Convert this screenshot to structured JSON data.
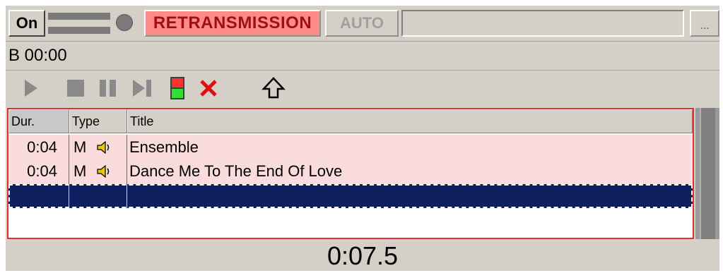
{
  "topbar": {
    "on_label": "On",
    "retransmission_label": "RETRANSMISSION",
    "auto_label": "AUTO",
    "status_text": "",
    "more_label": "..."
  },
  "time_line": "B 00:00",
  "toolbar": {
    "icons": [
      "play-icon",
      "stop-icon",
      "pause-icon",
      "next-icon",
      "traffic-light-icon",
      "delete-icon",
      "up-arrow-icon"
    ]
  },
  "playlist": {
    "columns": [
      "Dur.",
      "Type",
      "Title"
    ],
    "rows": [
      {
        "dur": "0:04",
        "type": "M",
        "title": "Ensemble"
      },
      {
        "dur": "0:04",
        "type": "M",
        "title": "Dance Me To The End Of Love"
      }
    ]
  },
  "big_clock": "0:07.5",
  "colors": {
    "retransmission_bg": "#ff8a8a",
    "row_bg": "#fadcdc",
    "selected_row": "#0f1f60",
    "playlist_border": "#e03030"
  }
}
